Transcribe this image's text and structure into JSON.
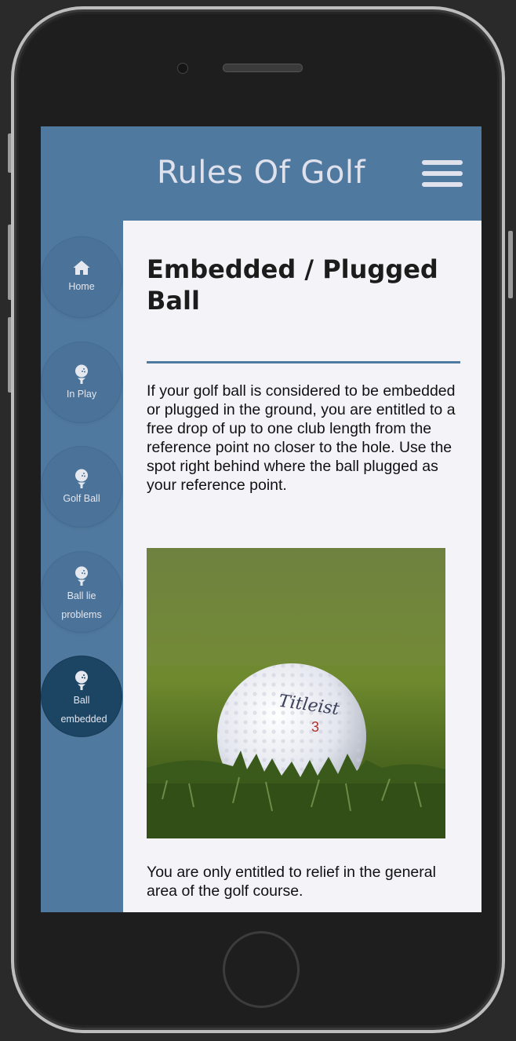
{
  "app": {
    "title": "Rules Of Golf",
    "menu_icon": "hamburger-menu-icon"
  },
  "sidebar": {
    "items": [
      {
        "label": "Home",
        "icon": "home-icon",
        "active": false
      },
      {
        "label": "In Play",
        "icon": "golf-ball-tee-icon",
        "active": false
      },
      {
        "label": "Golf Ball",
        "icon": "golf-ball-tee-icon",
        "active": false
      },
      {
        "label_lines": [
          "Ball lie",
          "problems"
        ],
        "icon": "golf-ball-tee-icon",
        "active": false
      },
      {
        "label_lines": [
          "Ball",
          "embedded"
        ],
        "icon": "golf-ball-tee-icon",
        "active": true
      }
    ]
  },
  "article": {
    "title": "Embedded / Plugged Ball",
    "intro": "If your golf ball is considered to be embedded or plugged in the ground, you are entitled to a free drop of up to one club length from the reference point no closer to the hole. Use the spot right behind where the ball plugged as your reference point.",
    "image_ball_brand": "Titleist",
    "image_ball_number": "3",
    "note": "You are only entitled to relief in the general area of the golf course."
  },
  "colors": {
    "header_bg": "#50799f",
    "active_nav": "#1c4463",
    "content_bg": "#f4f3f8",
    "divider": "#4f7aa0"
  }
}
